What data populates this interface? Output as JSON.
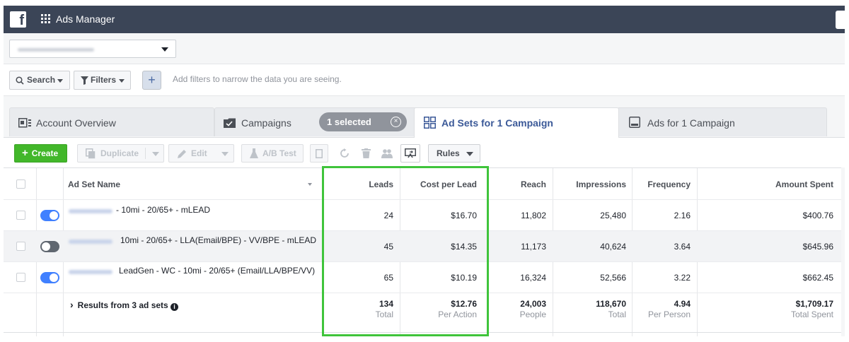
{
  "app": {
    "logo": "f",
    "title": "Ads Manager"
  },
  "filters": {
    "search_label": "Search",
    "filters_label": "Filters",
    "add_label": "+",
    "hint": "Add filters to narrow the data you are seeing."
  },
  "tabs": [
    {
      "label": "Account Overview",
      "icon": "account-overview-icon"
    },
    {
      "label": "Campaigns",
      "icon": "campaigns-folder-icon"
    },
    {
      "label": "Ad Sets for 1 Campaign",
      "icon": "ad-sets-icon"
    },
    {
      "label": "Ads for 1 Campaign",
      "icon": "ads-icon"
    }
  ],
  "selection": {
    "label": "1 selected",
    "clear": "×"
  },
  "toolbar": {
    "create": "Create",
    "duplicate": "Duplicate",
    "edit": "Edit",
    "ab_test": "A/B Test",
    "rules": "Rules"
  },
  "table": {
    "columns": {
      "name": "Ad Set Name",
      "leads": "Leads",
      "cpl": "Cost per Lead",
      "reach": "Reach",
      "impressions": "Impressions",
      "frequency": "Frequency",
      "amount": "Amount Spent"
    },
    "rows": [
      {
        "name": "- 10mi - 20/65+ - mLEAD",
        "active": true,
        "leads": "24",
        "cpl": "$16.70",
        "reach": "11,802",
        "impressions": "25,480",
        "frequency": "2.16",
        "amount": "$400.76"
      },
      {
        "name": "10mi - 20/65+ - LLA(Email/BPE) - VV/BPE - mLEAD",
        "active": false,
        "leads": "45",
        "cpl": "$14.35",
        "reach": "11,173",
        "impressions": "40,624",
        "frequency": "3.64",
        "amount": "$645.96"
      },
      {
        "name": "LeadGen - WC - 10mi - 20/65+ (Email/LLA/BPE/VV)",
        "active": true,
        "leads": "65",
        "cpl": "$10.19",
        "reach": "16,324",
        "impressions": "52,566",
        "frequency": "3.22",
        "amount": "$662.45"
      }
    ],
    "summary": {
      "label": "Results from 3 ad sets",
      "leads": "134",
      "leads_sub": "Total",
      "cpl": "$12.76",
      "cpl_sub": "Per Action",
      "reach": "24,003",
      "reach_sub": "People",
      "impressions": "118,670",
      "impressions_sub": "Total",
      "frequency": "4.94",
      "frequency_sub": "Per Person",
      "amount": "$1,709.17",
      "amount_sub": "Total Spent"
    }
  },
  "colors": {
    "topbar": "#3b4557",
    "create": "#42b72a",
    "highlight": "#3fc43b",
    "toggle_on": "#4080ff"
  }
}
